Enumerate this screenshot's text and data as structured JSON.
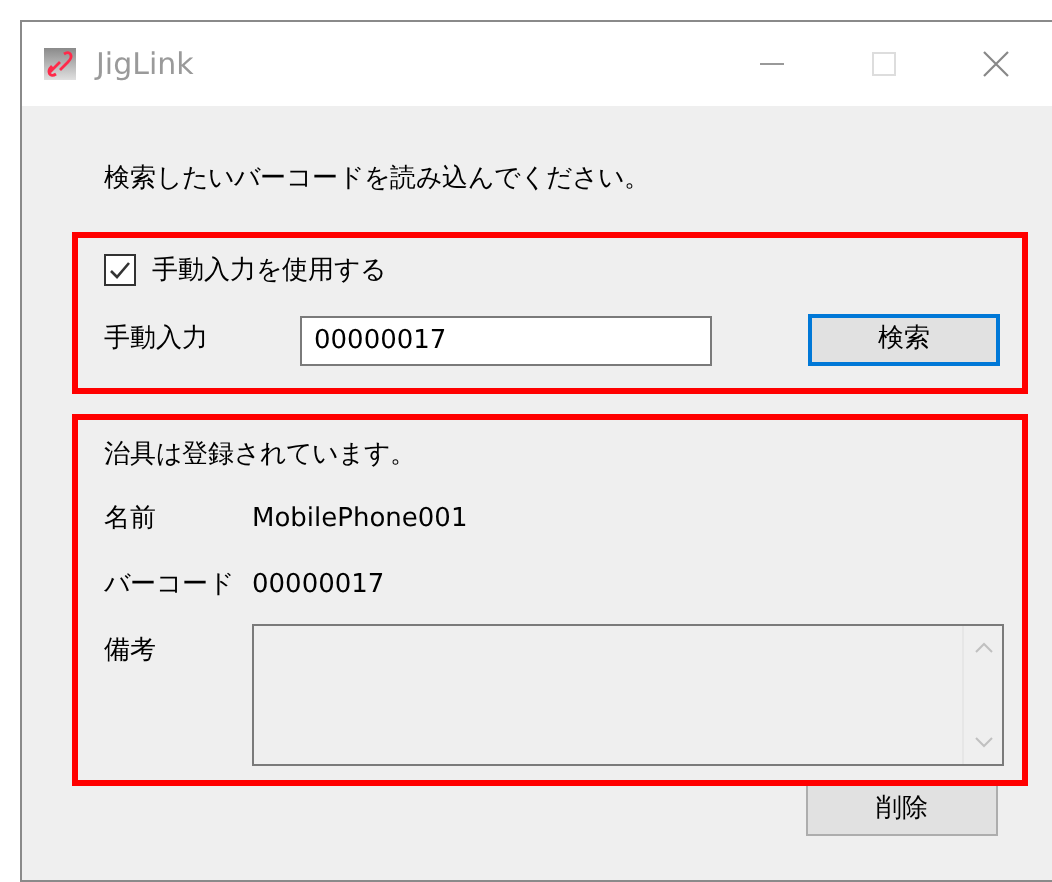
{
  "window": {
    "title": "JigLink"
  },
  "instruction": "検索したいバーコードを読み込んでください。",
  "manual_section": {
    "checkbox": {
      "label": "手動入力を使用する",
      "checked": true
    },
    "field": {
      "label": "手動入力",
      "value": "00000017"
    },
    "search_button": {
      "label": "検索",
      "focused": true
    }
  },
  "result_section": {
    "status": "治具は登録されています。",
    "rows": [
      {
        "label": "名前",
        "value": "MobilePhone001"
      },
      {
        "label": "バーコード",
        "value": "00000017"
      }
    ],
    "notes": {
      "label": "備考"
    }
  },
  "delete_button": {
    "label": "削除"
  }
}
